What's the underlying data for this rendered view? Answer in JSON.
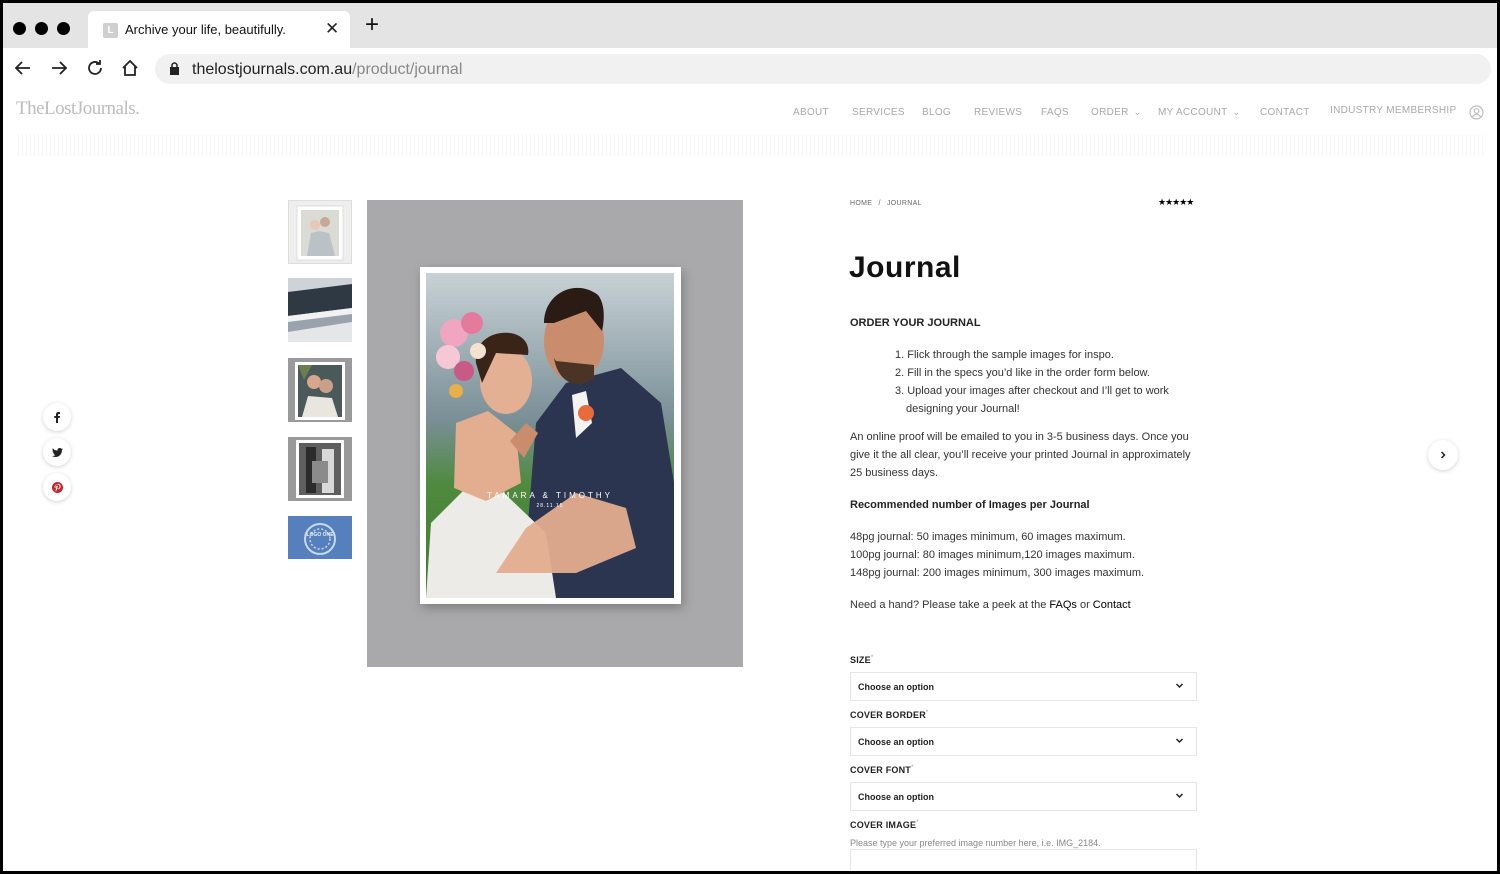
{
  "browser": {
    "tab_title": "Archive your life, beautifully.",
    "favicon_letter": "L",
    "url_domain": "thelostjournals.com.au",
    "url_path": "/product/journal"
  },
  "site": {
    "logo": "TheLostJournals.",
    "menu": [
      {
        "label": "ABOUT"
      },
      {
        "label": "SERVICES"
      },
      {
        "label": "BLOG"
      },
      {
        "label": "REVIEWS"
      },
      {
        "label": "FAQS"
      },
      {
        "label": "ORDER"
      },
      {
        "label": "MY ACCOUNT"
      },
      {
        "label": "CONTACT"
      },
      {
        "label": "INDUSTRY MEMBERSHIP"
      }
    ]
  },
  "gallery": {
    "cover_names": "TAMARA & TIMOTHY",
    "cover_date": "28.11.15",
    "thumb_stamp": "LOGO ONE"
  },
  "product": {
    "breadcrumb": {
      "home": "HOME",
      "sep": "/",
      "current": "JOURNAL"
    },
    "rating_stars": "★★★★★",
    "rating": 5,
    "title": "Journal",
    "order_heading": "ORDER YOUR JOURNAL",
    "steps": [
      "1. Flick through the sample images for inspo.",
      "2. Fill in the specs you’d like in the order form below.",
      "3. Upload your images after checkout and I’ll get to work designing your Journal!"
    ],
    "proof_text": "An online proof will be emailed to you in 3-5 business days. Once you give it the all clear, you’ll receive your printed Journal in approximately 25 business days.",
    "recommended_heading": "Recommended number of Images per Journal",
    "recommendations": [
      "48pg journal: 50 images minimum, 60 images maximum.",
      "100pg journal: 80 images minimum,120 images maximum.",
      "148pg journal: 200 images minimum, 300 images maximum."
    ],
    "help_prefix": "Need a hand? Please take a peek at the ",
    "help_faqs": "FAQs",
    "help_or": " or ",
    "help_contact": "Contact"
  },
  "form": {
    "required_mark": "*",
    "size_label": "SIZE",
    "size_value": "Choose an option",
    "border_label": "COVER BORDER",
    "border_value": "Choose an option",
    "font_label": "COVER FONT",
    "font_value": "Choose an option",
    "image_label": "COVER IMAGE",
    "image_hint": "Please type your preferred image number here, i.e. IMG_2184."
  }
}
